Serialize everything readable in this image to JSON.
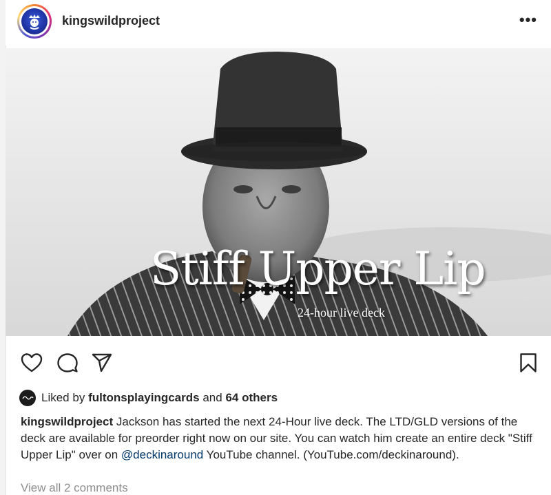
{
  "post": {
    "username": "kingswildproject",
    "more_label": "•••"
  },
  "photo": {
    "title": "Stiff Upper Lip",
    "subtitle": "24-hour live deck"
  },
  "icons": {
    "like": "heart-icon",
    "comment": "comment-icon",
    "share": "send-icon",
    "save": "bookmark-icon"
  },
  "likes": {
    "prefix": "Liked by",
    "user": "fultonsplayingcards",
    "joiner": "and",
    "others": "64 others"
  },
  "caption": {
    "username": "kingswildproject",
    "text_before": "Jackson has started the next 24-Hour live deck. The LTD/GLD versions of the deck are available for preorder right now on our site. You can watch him create an entire deck \"Stiff Upper Lip\" over on",
    "mention": "@deckinaround",
    "text_after": "YouTube channel. (YouTube.com/deckinaround)."
  },
  "comments": {
    "label": "View all 2 comments"
  }
}
